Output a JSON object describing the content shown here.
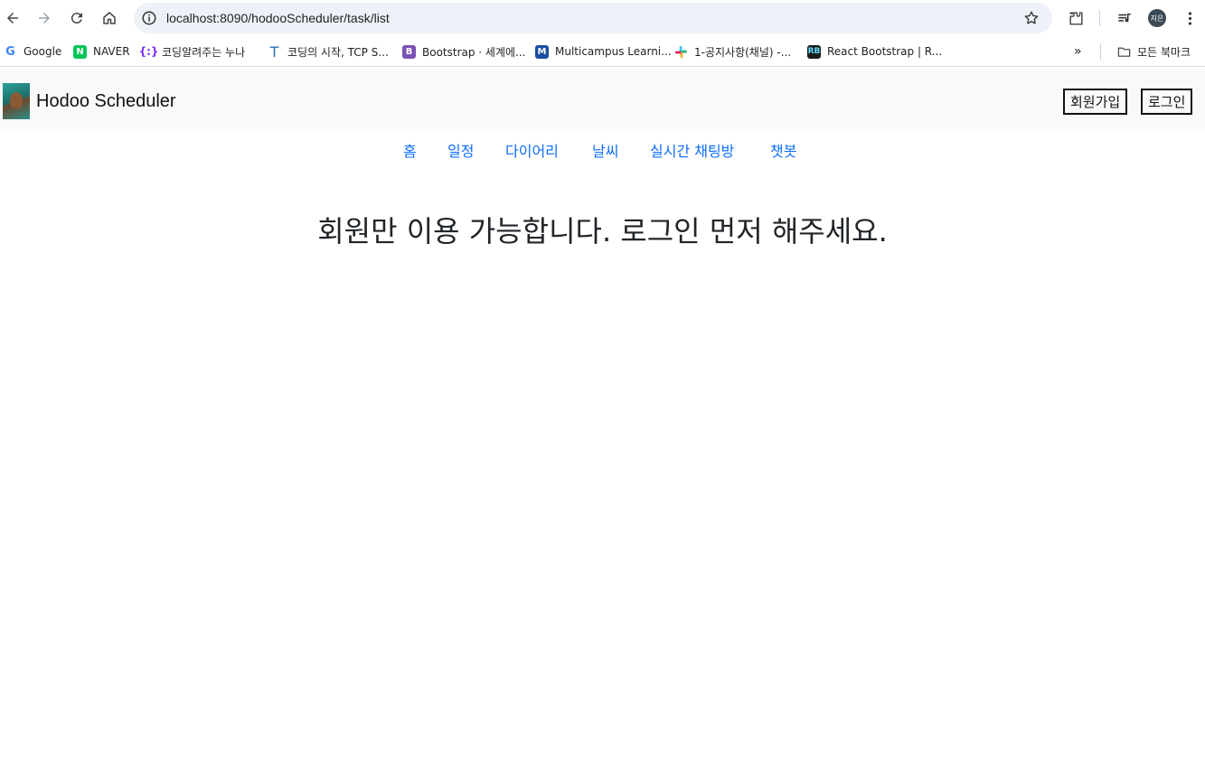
{
  "browser": {
    "url": "localhost:8090/hodooScheduler/task/list",
    "profile_initials": "지은",
    "icons": [
      "back-arrow-icon",
      "forward-arrow-icon",
      "reload-icon",
      "home-icon",
      "site-info-icon",
      "bookmark-star-icon",
      "extensions-icon",
      "media-queue-icon",
      "more-vert-icon"
    ]
  },
  "bookmarks": [
    {
      "label": "Google",
      "icon": "google-icon",
      "color": "#4285f4"
    },
    {
      "label": "NAVER",
      "icon": "naver-icon",
      "color": "#03c75a"
    },
    {
      "label": "코딩알려주는 누나",
      "icon": "braces-icon",
      "color": "#7b2ff7"
    },
    {
      "label": "코딩의 시작, TCP S...",
      "icon": "letter-t-icon",
      "color": "#2b6cb0"
    },
    {
      "label": "Bootstrap · 세계에...",
      "icon": "bootstrap-icon",
      "color": "#7952b3"
    },
    {
      "label": "Multicampus Learni...",
      "icon": "multicampus-icon",
      "color": "#1a4fa0"
    },
    {
      "label": "1-공지사항(채널) -...",
      "icon": "slack-icon",
      "color": "#e01e5a"
    },
    {
      "label": "React Bootstrap | R...",
      "icon": "react-bootstrap-icon",
      "color": "#1c1c1c"
    }
  ],
  "bookmarks_folder": "모든 북마크",
  "app": {
    "brand": "Hodoo Scheduler",
    "signup_label": "회원가입",
    "login_label": "로그인",
    "menu": [
      "홈",
      "일정",
      "다이어리",
      "날씨",
      "실시간 채팅방",
      "챗봇"
    ],
    "link_color": "#0d6efd",
    "notice": "회원만 이용 가능합니다. 로그인 먼저 해주세요."
  }
}
